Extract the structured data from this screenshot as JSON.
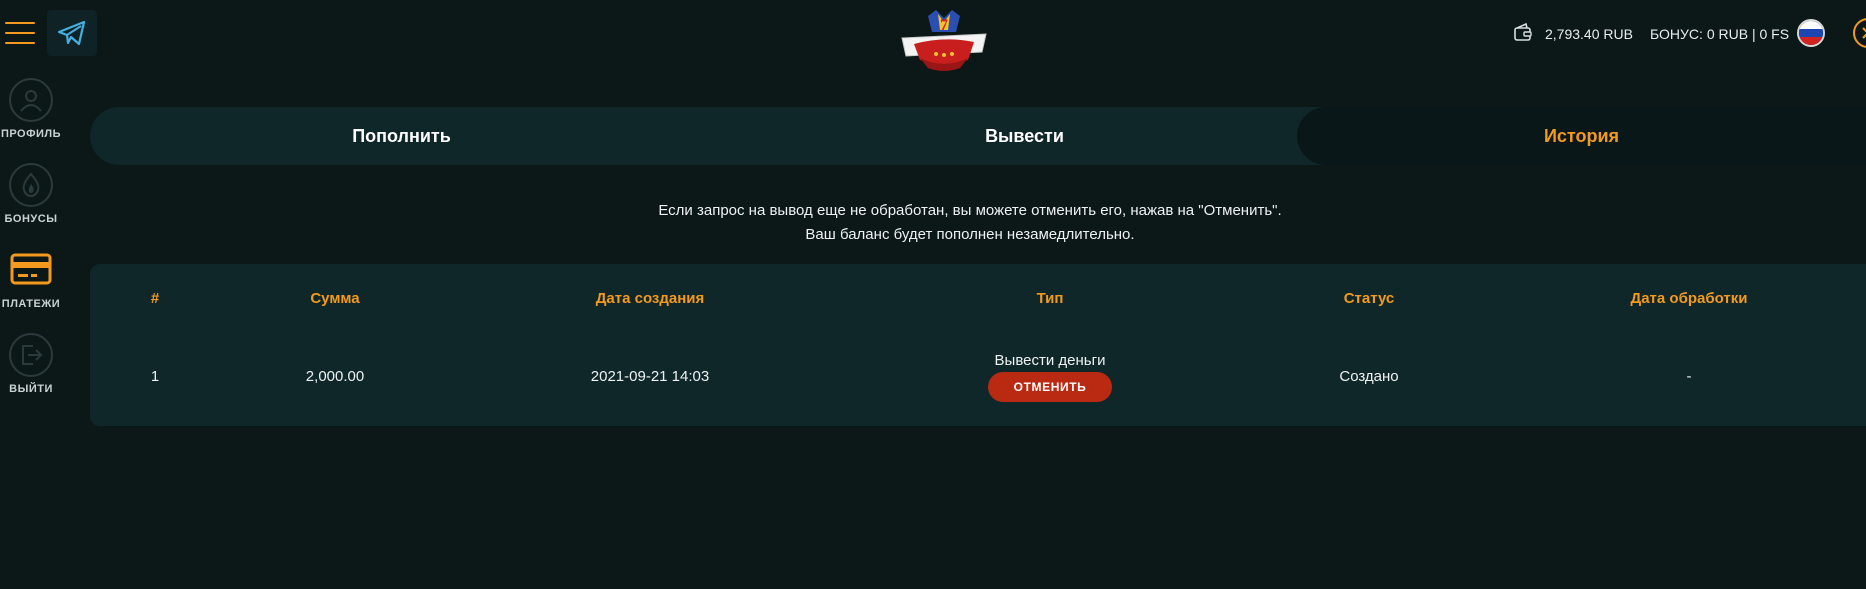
{
  "header": {
    "balance": "2,793.40 RUB",
    "bonus": "БОНУС: 0 RUB | 0 FS",
    "logo_text": "ФАРТОВОЕ КАЗИНО"
  },
  "sidebar": {
    "items": [
      {
        "label": "ПРОФИЛЬ",
        "icon": "user-icon",
        "active": false
      },
      {
        "label": "БОНУСЫ",
        "icon": "flame-icon",
        "active": false
      },
      {
        "label": "ПЛАТЕЖИ",
        "icon": "card-icon",
        "active": true
      },
      {
        "label": "ВЫЙТИ",
        "icon": "logout-icon",
        "active": false
      }
    ]
  },
  "tabs": [
    {
      "label": "Пополнить",
      "active": false
    },
    {
      "label": "Вывести",
      "active": false
    },
    {
      "label": "История",
      "active": true
    }
  ],
  "notice": {
    "line1": "Если запрос на вывод еще не обработан, вы можете отменить его, нажав на \"Отменить\".",
    "line2": "Ваш баланс будет пополнен незамедлительно."
  },
  "table": {
    "headers": [
      "#",
      "Сумма",
      "Дата создания",
      "Тип",
      "Статус",
      "Дата обработки"
    ],
    "rows": [
      {
        "num": "1",
        "amount": "2,000.00",
        "created": "2021-09-21 14:03",
        "type": "Вывести деньги",
        "action": "ОТМЕНИТЬ",
        "status": "Создано",
        "processed": "-"
      }
    ]
  },
  "colors": {
    "accent": "#f39a1e",
    "background": "#0c1718",
    "panel": "#10272a",
    "cancel": "#ba2a12"
  }
}
